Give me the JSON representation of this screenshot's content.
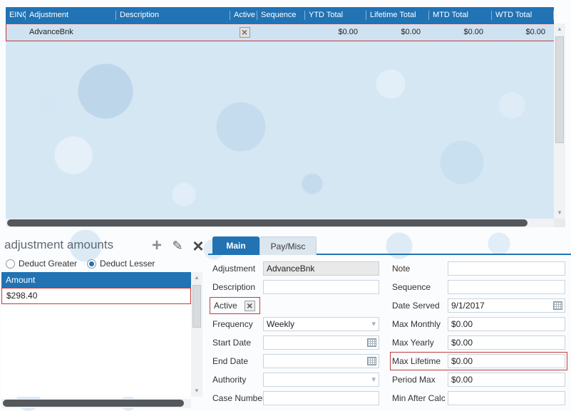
{
  "colors": {
    "accent_blue": "#2173b4",
    "highlight_red": "#c43b3b",
    "selected_row_bg": "#cfe2f1"
  },
  "icons": [
    "add-icon",
    "edit-pencil-icon",
    "delete-x-icon",
    "calendar-icon",
    "chevron-down-icon",
    "scroll-up-icon",
    "scroll-down-icon",
    "checkbox-x-icon"
  ],
  "grid": {
    "columns": [
      "EINC",
      "Adjustment",
      "Description",
      "Active",
      "Sequence",
      "YTD Total",
      "Lifetime Total",
      "MTD Total",
      "WTD Total"
    ],
    "row": {
      "einc": "",
      "adjustment": "AdvanceBnk",
      "description": "",
      "active_checked": true,
      "sequence": "",
      "ytd_total": "$0.00",
      "lifetime_total": "$0.00",
      "mtd_total": "$0.00",
      "wtd_total": "$0.00"
    }
  },
  "amounts_panel": {
    "title": "adjustment amounts",
    "radio_options": [
      {
        "label": "Deduct Greater",
        "selected": false
      },
      {
        "label": "Deduct Lesser",
        "selected": true
      }
    ],
    "column_header": "Amount",
    "rows": [
      "$298.40"
    ]
  },
  "detail_panel": {
    "tabs": [
      {
        "label": "Main",
        "active": true
      },
      {
        "label": "Pay/Misc",
        "active": false
      }
    ],
    "left_fields": [
      {
        "label": "Adjustment",
        "value": "AdvanceBnk",
        "type": "readonly-text"
      },
      {
        "label": "Description",
        "value": "",
        "type": "text"
      },
      {
        "label": "Active",
        "value": "checked",
        "type": "checkbox",
        "highlighted": true
      },
      {
        "label": "Frequency",
        "value": "Weekly",
        "type": "dropdown"
      },
      {
        "label": "Start Date",
        "value": "",
        "type": "date"
      },
      {
        "label": "End Date",
        "value": "",
        "type": "date"
      },
      {
        "label": "Authority",
        "value": "",
        "type": "dropdown"
      },
      {
        "label": "Case Number",
        "value": "",
        "type": "text"
      }
    ],
    "right_fields": [
      {
        "label": "Note",
        "value": "",
        "type": "text"
      },
      {
        "label": "Sequence",
        "value": "",
        "type": "text"
      },
      {
        "label": "Date Served",
        "value": "9/1/2017",
        "type": "date"
      },
      {
        "label": "Max Monthly",
        "value": "$0.00",
        "type": "text"
      },
      {
        "label": "Max Yearly",
        "value": "$0.00",
        "type": "text"
      },
      {
        "label": "Max Lifetime",
        "value": "$0.00",
        "type": "text",
        "highlighted": true
      },
      {
        "label": "Period Max",
        "value": "$0.00",
        "type": "text"
      },
      {
        "label": "Min After Calc",
        "value": "",
        "type": "text"
      }
    ]
  }
}
